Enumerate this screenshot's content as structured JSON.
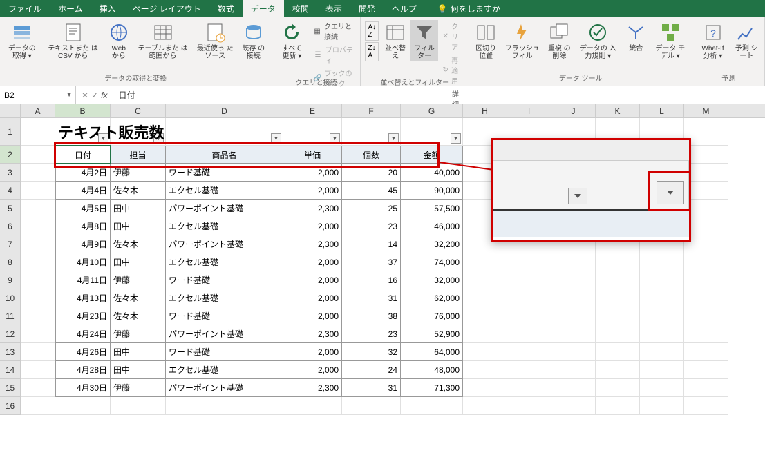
{
  "tabs": {
    "file": "ファイル",
    "home": "ホーム",
    "insert": "挿入",
    "layout": "ページ レイアウト",
    "formulas": "数式",
    "data": "データ",
    "review": "校閲",
    "view": "表示",
    "developer": "開発",
    "help": "ヘルプ",
    "tell_me": "何をしますか"
  },
  "ribbon": {
    "get_data": "データの\n取得 ▾",
    "from_csv": "テキストまた\nは CSV から",
    "from_web": "Web\nから",
    "from_range": "テーブルまた\nは範囲から",
    "recent": "最近使っ\nたソース",
    "existing": "既存\nの接続",
    "group1": "データの取得と変換",
    "refresh": "すべて\n更新 ▾",
    "queries": "クエリと接続",
    "properties": "プロパティ",
    "links": "ブックのリンク",
    "group2": "クエリと接続",
    "sort": "並べ替え",
    "filter": "フィルター",
    "clear": "クリア",
    "reapply": "再適用",
    "advanced": "詳細設定",
    "group3": "並べ替えとフィルター",
    "text_cols": "区切り位置",
    "flash": "フラッシュ\nフィル",
    "dup": "重複\nの削除",
    "validation": "データの\n入力規則 ▾",
    "consolidate": "統合",
    "data_model": "データ モ\nデル ▾",
    "group4": "データ ツール",
    "whatif": "What-If 分析\n▾",
    "forecast": "予測\nシート",
    "group5": "予測"
  },
  "formula": {
    "name": "B2",
    "value": "日付"
  },
  "cols": [
    "A",
    "B",
    "C",
    "D",
    "E",
    "F",
    "G",
    "H",
    "I",
    "J",
    "K",
    "L",
    "M"
  ],
  "title": "テキスト販売数",
  "headers": {
    "b": "日付",
    "c": "担当",
    "d": "商品名",
    "e": "単価",
    "f": "個数",
    "g": "金額"
  },
  "rows": [
    {
      "b": "4月2日",
      "c": "伊藤",
      "d": "ワード基礎",
      "e": "2,000",
      "f": "20",
      "g": "40,000"
    },
    {
      "b": "4月4日",
      "c": "佐々木",
      "d": "エクセル基礎",
      "e": "2,000",
      "f": "45",
      "g": "90,000"
    },
    {
      "b": "4月5日",
      "c": "田中",
      "d": "パワーポイント基礎",
      "e": "2,300",
      "f": "25",
      "g": "57,500"
    },
    {
      "b": "4月8日",
      "c": "田中",
      "d": "エクセル基礎",
      "e": "2,000",
      "f": "23",
      "g": "46,000"
    },
    {
      "b": "4月9日",
      "c": "佐々木",
      "d": "パワーポイント基礎",
      "e": "2,300",
      "f": "14",
      "g": "32,200"
    },
    {
      "b": "4月10日",
      "c": "田中",
      "d": "エクセル基礎",
      "e": "2,000",
      "f": "37",
      "g": "74,000"
    },
    {
      "b": "4月11日",
      "c": "伊藤",
      "d": "ワード基礎",
      "e": "2,000",
      "f": "16",
      "g": "32,000"
    },
    {
      "b": "4月13日",
      "c": "佐々木",
      "d": "エクセル基礎",
      "e": "2,000",
      "f": "31",
      "g": "62,000"
    },
    {
      "b": "4月23日",
      "c": "佐々木",
      "d": "ワード基礎",
      "e": "2,000",
      "f": "38",
      "g": "76,000"
    },
    {
      "b": "4月24日",
      "c": "伊藤",
      "d": "パワーポイント基礎",
      "e": "2,300",
      "f": "23",
      "g": "52,900"
    },
    {
      "b": "4月26日",
      "c": "田中",
      "d": "ワード基礎",
      "e": "2,000",
      "f": "32",
      "g": "64,000"
    },
    {
      "b": "4月28日",
      "c": "田中",
      "d": "エクセル基礎",
      "e": "2,000",
      "f": "24",
      "g": "48,000"
    },
    {
      "b": "4月30日",
      "c": "伊藤",
      "d": "パワーポイント基礎",
      "e": "2,300",
      "f": "31",
      "g": "71,300"
    }
  ]
}
